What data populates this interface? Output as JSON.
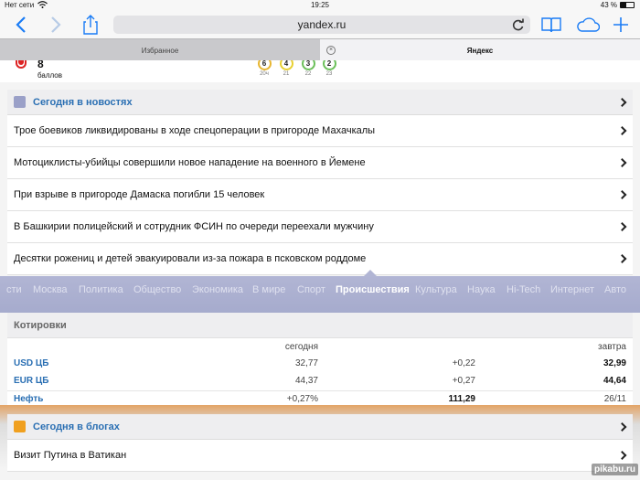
{
  "statusbar": {
    "carrier": "Нет сети",
    "time": "19:25",
    "battery": "43 %",
    "battery_level": 0.43
  },
  "browser": {
    "url": "yandex.ru",
    "tabs": [
      {
        "label": "Избранное",
        "active": false
      },
      {
        "label": "Яндекс",
        "active": true
      }
    ]
  },
  "traffic": {
    "score": "8",
    "score_label": "баллов",
    "forecast": [
      {
        "value": "6",
        "hour": "20ч",
        "color": "#e8b630"
      },
      {
        "value": "4",
        "hour": "21",
        "color": "#e8d030"
      },
      {
        "value": "3",
        "hour": "22",
        "color": "#6cc05a"
      },
      {
        "value": "2",
        "hour": "23",
        "color": "#6cc05a"
      }
    ]
  },
  "news": {
    "header": "Сегодня в новостях",
    "icon_color": "#9aa0c8",
    "items": [
      "Трое боевиков ликвидированы в ходе спецоперации в пригороде Махачкалы",
      "Мотоциклисты-убийцы совершили новое нападение на военного в Йемене",
      "При взрыве в пригороде Дамаска погибли 15 человек",
      "В Башкирии полицейский и сотрудник ФСИН по очереди переехали мужчину",
      "Десятки рожениц и детей эвакуировали из-за пожара в псковском роддоме"
    ]
  },
  "rubrics": {
    "items": [
      "сти",
      "Москва",
      "Политика",
      "Общество",
      "Экономика",
      "В мире",
      "Спорт",
      "Происшествия",
      "Культура",
      "Наука",
      "Hi-Tech",
      "Интернет",
      "Авто"
    ],
    "active": "Происшествия"
  },
  "quotes": {
    "header": "Котировки",
    "col_today": "сегодня",
    "col_tomorrow": "завтра",
    "rows": [
      {
        "name": "USD ЦБ",
        "today": "32,77",
        "change": "+0,22",
        "tomorrow": "32,99"
      },
      {
        "name": "EUR ЦБ",
        "today": "44,37",
        "change": "+0,27",
        "tomorrow": "44,64"
      },
      {
        "name": "Нефть",
        "today": "+0,27%",
        "change": "111,29",
        "tomorrow": "26/11"
      }
    ]
  },
  "blogs": {
    "header": "Сегодня в блогах",
    "icon_color": "#f0a020",
    "items": [
      "Визит Путина в Ватикан"
    ]
  },
  "watermark": "pikabu.ru",
  "colors": {
    "accent": "#1a7cf5",
    "link": "#2a6fb3"
  }
}
